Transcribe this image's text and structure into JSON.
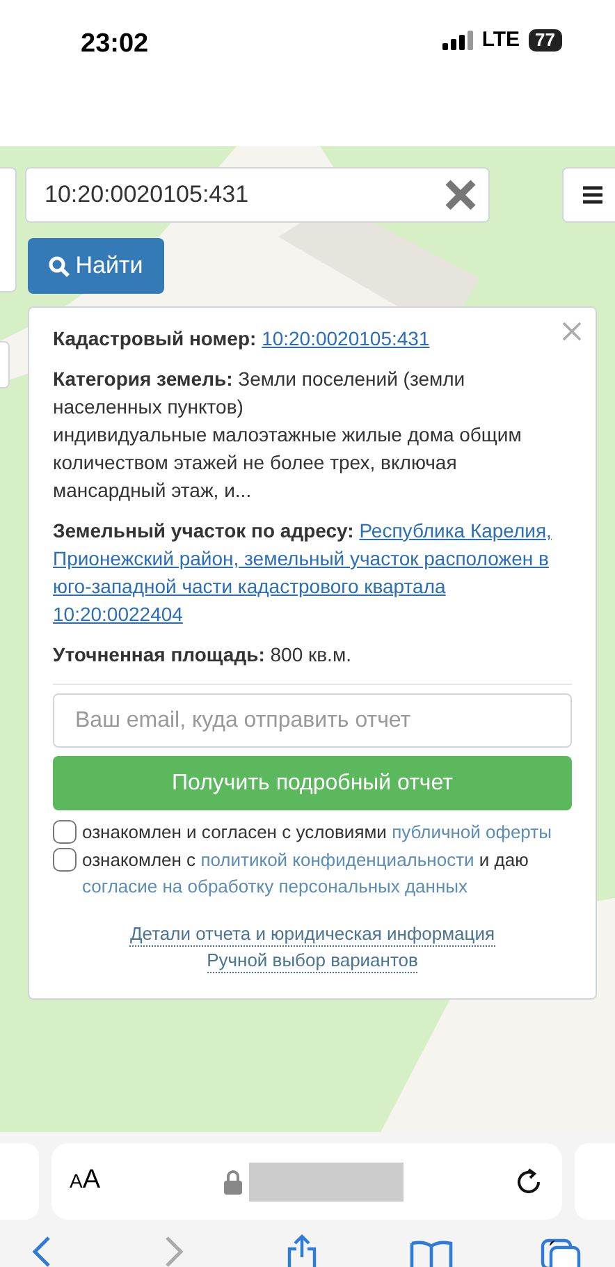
{
  "status_bar": {
    "time": "23:02",
    "network": "LTE",
    "battery": "77"
  },
  "search": {
    "value": "10:20:0020105:431",
    "button": "Найти"
  },
  "card": {
    "fields": [
      {
        "label": "Кадастровый номер:",
        "value": "10:20:0020105:431",
        "kind": "link"
      },
      {
        "label": "Категория земель:",
        "value": "Земли поселений (земли населенных пунктов)",
        "kind": "text",
        "note": "индивидуальные малоэтажные жилые дома общим количеством этажей не более трех, включая мансардный этаж, и..."
      },
      {
        "label": "Земельный участок по адресу:",
        "value_lines": [
          "Республика Карелия,",
          "Прионежский район, земельный участок расположен в",
          "юго-западной части кадастрового квартала",
          "10:20:0022404"
        ],
        "kind": "link"
      },
      {
        "label": "Уточненная площадь:",
        "value": "800 кв.м.",
        "kind": "text"
      }
    ],
    "email_placeholder": "Ваш email, куда отправить отчет",
    "submit": "Получить подробный отчет",
    "consents": [
      {
        "checked": false,
        "parts": [
          {
            "kind": "text",
            "text": "ознакомлен и согласен с условиями"
          },
          {
            "kind": "link",
            "text": "публичной оферты"
          }
        ]
      },
      {
        "checked": false,
        "parts": [
          {
            "kind": "text",
            "text": "ознакомлен с"
          },
          {
            "kind": "link",
            "text": "политикой конфиденциальности"
          },
          {
            "kind": "text",
            "text": "и даю"
          },
          {
            "kind": "link",
            "text": "согласие на обработку персональных данных"
          }
        ]
      }
    ],
    "footer_links": [
      "Детали отчета и юридическая информация",
      "Ручной выбор вариантов"
    ]
  },
  "browser": {
    "text_size_button": "AA"
  }
}
